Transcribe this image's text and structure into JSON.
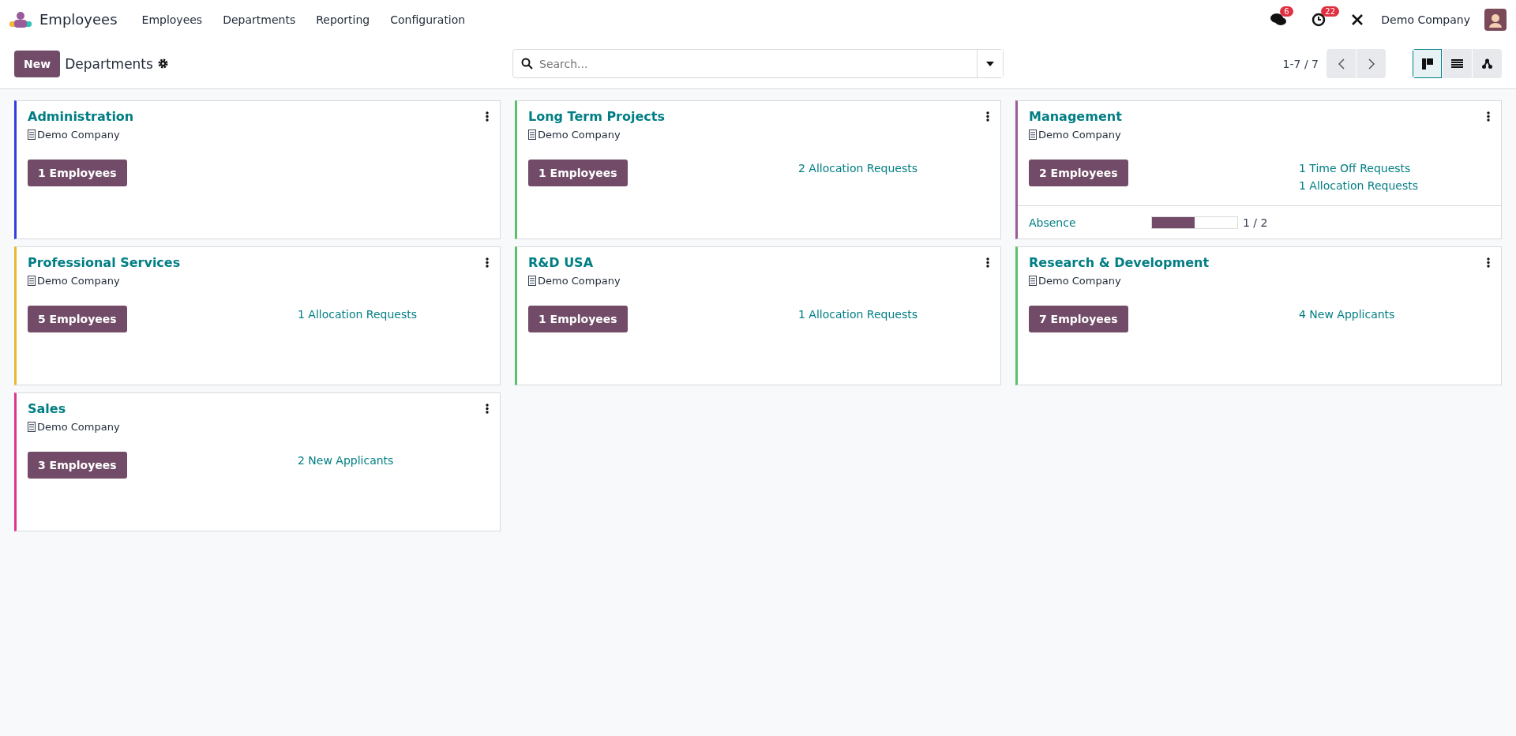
{
  "app": {
    "name": "Employees"
  },
  "menu": [
    "Employees",
    "Departments",
    "Reporting",
    "Configuration"
  ],
  "systray": {
    "messages_count": "6",
    "activities_count": "22",
    "company": "Demo Company"
  },
  "control_panel": {
    "new_button": "New",
    "title": "Departments",
    "search": {
      "placeholder": "Search..."
    },
    "pager": "1-7 / 7",
    "views": [
      {
        "kind": "kanban",
        "selected": true
      },
      {
        "kind": "list",
        "selected": false
      },
      {
        "kind": "hierarchy",
        "selected": false
      }
    ]
  },
  "cards": [
    {
      "name": "Administration",
      "company": "Demo Company",
      "color": "#3040e0",
      "employees": "1 Employees"
    },
    {
      "name": "Long Term Projects",
      "company": "Demo Company",
      "color": "#5cbf6b",
      "employees": "1 Employees",
      "links": [
        "2 Allocation Requests"
      ]
    },
    {
      "name": "Management",
      "company": "Demo Company",
      "color": "#9b5c9a",
      "employees": "2 Employees",
      "links": [
        "1 Time Off Requests",
        "1 Allocation Requests"
      ],
      "meters": [
        {
          "label": "Absence",
          "level": 0.5,
          "reading": "1 / 2"
        }
      ]
    },
    {
      "name": "Professional Services",
      "company": "Demo Company",
      "color": "#e8b830",
      "employees": "5 Employees",
      "links": [
        "1 Allocation Requests"
      ]
    },
    {
      "name": "R&D USA",
      "company": "Demo Company",
      "color": "#5cbf6b",
      "employees": "1 Employees",
      "links": [
        "1 Allocation Requests"
      ]
    },
    {
      "name": "Research & Development",
      "company": "Demo Company",
      "color": "#5cbf6b",
      "employees": "7 Employees",
      "links": [
        "4 New Applicants"
      ]
    },
    {
      "name": "Sales",
      "company": "Demo Company",
      "color": "#e0358a",
      "employees": "3 Employees",
      "links": [
        "2 New Applicants"
      ]
    }
  ]
}
